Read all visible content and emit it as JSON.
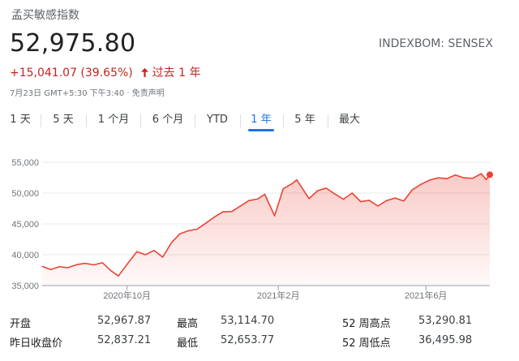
{
  "title": "孟买敏感指数",
  "price": "52,975.80",
  "ticker": "INDEXBOM: SENSEX",
  "change": {
    "text": "+15,041.07 (39.65%)",
    "arrow_icon": "arrow-up-icon",
    "period": "过去 1 年",
    "color": "#c5221f"
  },
  "timestamp": "7月23日 GMT+5:30 下午3:40 · 免责声明",
  "tabs": [
    {
      "label": "1 天"
    },
    {
      "label": "5 天"
    },
    {
      "label": "1 个月"
    },
    {
      "label": "6 个月"
    },
    {
      "label": "YTD"
    },
    {
      "label": "1 年",
      "active": true
    },
    {
      "label": "5 年"
    },
    {
      "label": "最大"
    }
  ],
  "accent_color": "#1a73e8",
  "line_color": "#ea4335",
  "chart_data": {
    "type": "area",
    "ylim": [
      35000,
      55000
    ],
    "yticks": [
      35000,
      40000,
      45000,
      50000,
      55000
    ],
    "ytick_labels": [
      "35,000",
      "40,000",
      "45,000",
      "50,000",
      "55,000"
    ],
    "xtick_labels": [
      "2020年10月",
      "2021年2月",
      "2021年6月"
    ],
    "xtick_dates": [
      "2020-10-01",
      "2021-02-01",
      "2021-06-01"
    ],
    "x_range": [
      "2020-07-24",
      "2021-07-23"
    ],
    "grid": true,
    "series": [
      {
        "x": [
          "2020-07-24",
          "2020-07-31",
          "2020-08-07",
          "2020-08-14",
          "2020-08-21",
          "2020-08-28",
          "2020-09-04",
          "2020-09-11",
          "2020-09-18",
          "2020-09-24",
          "2020-10-02",
          "2020-10-09",
          "2020-10-16",
          "2020-10-23",
          "2020-10-30",
          "2020-11-06",
          "2020-11-13",
          "2020-11-20",
          "2020-11-27",
          "2020-12-04",
          "2020-12-11",
          "2020-12-18",
          "2020-12-25",
          "2021-01-01",
          "2021-01-08",
          "2021-01-15",
          "2021-01-21",
          "2021-01-29",
          "2021-02-05",
          "2021-02-12",
          "2021-02-16",
          "2021-02-26",
          "2021-03-05",
          "2021-03-12",
          "2021-03-19",
          "2021-03-26",
          "2021-04-02",
          "2021-04-09",
          "2021-04-16",
          "2021-04-23",
          "2021-04-30",
          "2021-05-07",
          "2021-05-14",
          "2021-05-21",
          "2021-05-28",
          "2021-06-04",
          "2021-06-11",
          "2021-06-18",
          "2021-06-25",
          "2021-07-02",
          "2021-07-09",
          "2021-07-16",
          "2021-07-20",
          "2021-07-23"
        ],
        "values": [
          38100,
          37600,
          38050,
          37900,
          38400,
          38600,
          38360,
          38700,
          37400,
          36550,
          38700,
          40500,
          40000,
          40700,
          39600,
          41900,
          43400,
          43900,
          44150,
          45100,
          46100,
          46960,
          47000,
          47870,
          48780,
          49030,
          49800,
          46300,
          50700,
          51500,
          52150,
          49100,
          50400,
          50800,
          49850,
          49000,
          50000,
          48600,
          48830,
          47900,
          48780,
          49200,
          48730,
          50540,
          51420,
          52100,
          52470,
          52340,
          52920,
          52480,
          52390,
          53140,
          52200,
          52975
        ]
      }
    ]
  },
  "stats": [
    {
      "label": "开盘",
      "value": "52,967.87"
    },
    {
      "label": "最高",
      "value": "53,114.70"
    },
    {
      "label": "52 周高点",
      "value": "53,290.81"
    },
    {
      "label": "昨日收盘价",
      "value": "52,837.21"
    },
    {
      "label": "最低",
      "value": "52,653.77"
    },
    {
      "label": "52 周低点",
      "value": "36,495.98"
    }
  ]
}
